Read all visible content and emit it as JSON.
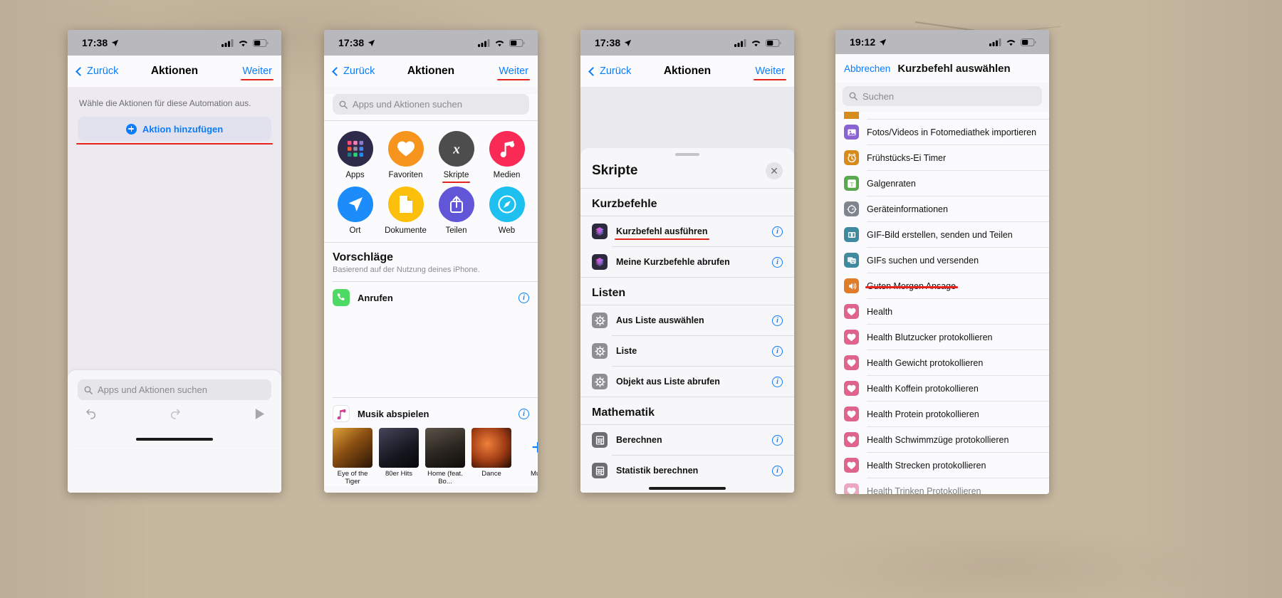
{
  "phone1": {
    "status": {
      "time": "17:38",
      "location_icon": "location-arrow-icon",
      "cellular_icon": "cellular-bars-icon",
      "wifi_icon": "wifi-icon",
      "battery_icon": "battery-icon"
    },
    "nav": {
      "back": "Zurück",
      "title": "Aktionen",
      "next": "Weiter"
    },
    "hint": "Wähle die Aktionen für diese Automation aus.",
    "add_action": "Aktion hinzufügen",
    "search_placeholder": "Apps und Aktionen suchen",
    "toolbar": {
      "undo": "undo-icon",
      "redo": "redo-icon",
      "play": "play-icon"
    }
  },
  "phone2": {
    "status": {
      "time": "17:38"
    },
    "nav": {
      "back": "Zurück",
      "title": "Aktionen",
      "next": "Weiter"
    },
    "search_placeholder": "Apps und Aktionen suchen",
    "grid": [
      {
        "label": "Apps",
        "icon": "apps-grid-icon",
        "color": "#2d2a4a"
      },
      {
        "label": "Favoriten",
        "icon": "heart-icon",
        "color": "#f7941d"
      },
      {
        "label": "Skripte",
        "icon": "x-script-icon",
        "color": "#4d4d4d",
        "highlighted": true
      },
      {
        "label": "Medien",
        "icon": "music-note-icon",
        "color": "#fa2a56"
      },
      {
        "label": "Ort",
        "icon": "navigation-arrow-icon",
        "color": "#1b8cfa"
      },
      {
        "label": "Dokumente",
        "icon": "document-icon",
        "color": "#fcc00c"
      },
      {
        "label": "Teilen",
        "icon": "share-icon",
        "color": "#6155d8"
      },
      {
        "label": "Web",
        "icon": "compass-icon",
        "color": "#1ec0f0"
      }
    ],
    "suggestions": {
      "title": "Vorschläge",
      "subtitle": "Basierend auf der Nutzung deines iPhone."
    },
    "rows": [
      {
        "label": "Anrufen",
        "icon": "phone-icon",
        "color": "#4cd964"
      },
      {
        "label": "Musik abspielen",
        "icon": "apple-music-icon",
        "color": "#ffffff"
      }
    ],
    "albums": [
      {
        "caption": "Eye of\nthe Tiger",
        "c1": "#c9811e",
        "c2": "#3a2208"
      },
      {
        "caption": "80er Hits",
        "c1": "#2a2b34",
        "c2": "#0c0c12"
      },
      {
        "caption": "Home\n(feat. Bo...",
        "c1": "#3a3631",
        "c2": "#15120f"
      },
      {
        "caption": "Dance",
        "c1": "#b0451c",
        "c2": "#2a1007"
      },
      {
        "caption": "Musi",
        "c1": "#ffffff",
        "c2": "#ffffff",
        "is_add": true
      }
    ],
    "add_album_label": "+"
  },
  "phone3": {
    "status": {
      "time": "17:38"
    },
    "nav": {
      "back": "Zurück",
      "title": "Aktionen",
      "next": "Weiter"
    },
    "sheet": {
      "title": "Skripte",
      "close_icon": "close-x-icon"
    },
    "groups": [
      {
        "title": "Kurzbefehle",
        "items": [
          {
            "label": "Kurzbefehl ausführen",
            "icon": "shortcuts-app-icon",
            "color": "#2b2b3d",
            "highlighted": true
          },
          {
            "label": "Meine Kurzbefehle abrufen",
            "icon": "shortcuts-app-icon",
            "color": "#2b2b3d"
          }
        ]
      },
      {
        "title": "Listen",
        "items": [
          {
            "label": "Aus Liste auswählen",
            "icon": "gear-icon",
            "color": "#8e8e93"
          },
          {
            "label": "Liste",
            "icon": "gear-icon",
            "color": "#8e8e93"
          },
          {
            "label": "Objekt aus Liste abrufen",
            "icon": "gear-icon",
            "color": "#8e8e93"
          }
        ]
      },
      {
        "title": "Mathematik",
        "items": [
          {
            "label": "Berechnen",
            "icon": "calculator-icon",
            "color": "#6d6d72"
          },
          {
            "label": "Statistik berechnen",
            "icon": "calculator-icon",
            "color": "#6d6d72"
          }
        ]
      }
    ]
  },
  "phone4": {
    "status": {
      "time": "19:12"
    },
    "nav": {
      "cancel": "Abbrechen",
      "title": "Kurzbefehl auswählen"
    },
    "search_placeholder": "Suchen",
    "items": [
      {
        "label": "Fotos/Videos in Fotomediathek importieren",
        "icon": "photos-icon",
        "color": "#8a63d2"
      },
      {
        "label": "Frühstücks-Ei Timer",
        "icon": "alarm-clock-icon",
        "color": "#d78b1c"
      },
      {
        "label": "Galgenraten",
        "icon": "text-t-icon",
        "color": "#5aa84f"
      },
      {
        "label": "Geräteinformationen",
        "icon": "device-info-icon",
        "color": "#7e858e"
      },
      {
        "label": "GIF-Bild erstellen, senden und Teilen",
        "icon": "gif-frame-icon",
        "color": "#3f8a9e"
      },
      {
        "label": "GIFs suchen und versenden",
        "icon": "masks-icon",
        "color": "#3f8a9e"
      },
      {
        "label": "Guten Morgen Ansage",
        "icon": "speaker-icon",
        "color": "#e07b2a",
        "highlighted": true
      },
      {
        "label": "Health",
        "icon": "heart-icon",
        "color": "#e0638e"
      },
      {
        "label": "Health Blutzucker protokollieren",
        "icon": "heart-icon",
        "color": "#e0638e"
      },
      {
        "label": "Health Gewicht protokollieren",
        "icon": "heart-icon",
        "color": "#e0638e"
      },
      {
        "label": "Health Koffein protokollieren",
        "icon": "heart-icon",
        "color": "#e0638e"
      },
      {
        "label": "Health Protein protokollieren",
        "icon": "heart-icon",
        "color": "#e0638e"
      },
      {
        "label": "Health Schwimmzüge protokollieren",
        "icon": "heart-icon",
        "color": "#e0638e"
      },
      {
        "label": "Health Strecken protokollieren",
        "icon": "heart-icon",
        "color": "#e0638e"
      },
      {
        "label": "Health Trinken Protokollieren",
        "icon": "heart-icon",
        "color": "#e0638e"
      }
    ]
  },
  "colors": {
    "accent_blue": "#0a7cff",
    "annotation_red": "#e8231b"
  }
}
